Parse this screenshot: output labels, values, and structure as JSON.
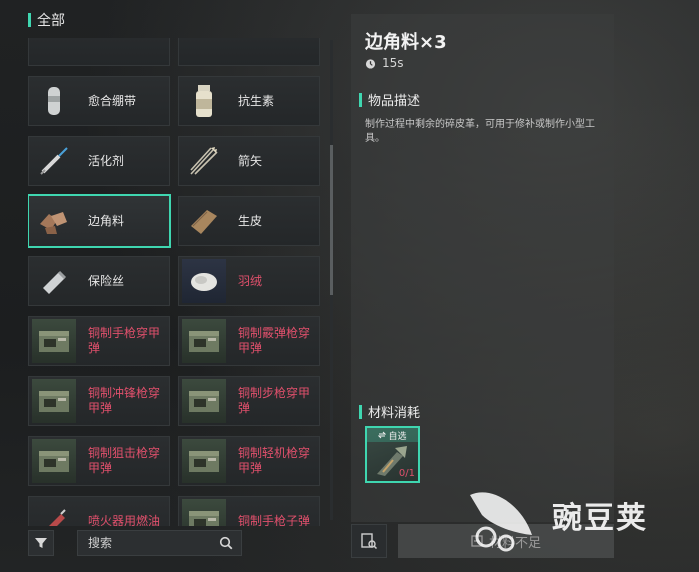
{
  "list": {
    "header": "全部",
    "items": [
      {
        "label": "",
        "icon": "partial-item-icon",
        "red": false,
        "thumb": "plain"
      },
      {
        "label": "",
        "icon": "partial-item-icon",
        "red": false,
        "thumb": "plain"
      },
      {
        "label": "愈合绷带",
        "icon": "bandage-icon",
        "red": false,
        "thumb": "plain"
      },
      {
        "label": "抗生素",
        "icon": "pill-bottle-icon",
        "red": false,
        "thumb": "plain"
      },
      {
        "label": "活化剂",
        "icon": "syringe-icon",
        "red": false,
        "thumb": "plain"
      },
      {
        "label": "箭矢",
        "icon": "arrows-icon",
        "red": false,
        "thumb": "plain"
      },
      {
        "label": "边角料",
        "icon": "leather-scraps-icon",
        "red": false,
        "thumb": "plain"
      },
      {
        "label": "生皮",
        "icon": "rawhide-icon",
        "red": false,
        "thumb": "plain"
      },
      {
        "label": "保险丝",
        "icon": "fuse-icon",
        "red": false,
        "thumb": "plain"
      },
      {
        "label": "羽绒",
        "icon": "down-feather-icon",
        "red": true,
        "thumb": "blue"
      },
      {
        "label": "铜制手枪穿甲弹",
        "icon": "ammo-box-icon",
        "red": true,
        "thumb": "green"
      },
      {
        "label": "铜制霰弹枪穿甲弹",
        "icon": "ammo-box-icon",
        "red": true,
        "thumb": "green"
      },
      {
        "label": "铜制冲锋枪穿甲弹",
        "icon": "ammo-box-icon",
        "red": true,
        "thumb": "green"
      },
      {
        "label": "铜制步枪穿甲弹",
        "icon": "ammo-box-icon",
        "red": true,
        "thumb": "green"
      },
      {
        "label": "铜制狙击枪穿甲弹",
        "icon": "ammo-box-icon",
        "red": true,
        "thumb": "green"
      },
      {
        "label": "铜制轻机枪穿甲弹",
        "icon": "ammo-box-icon",
        "red": true,
        "thumb": "green"
      },
      {
        "label": "喷火器用燃油",
        "icon": "fuel-icon",
        "red": true,
        "thumb": "plain"
      },
      {
        "label": "铜制手枪子弹",
        "icon": "ammo-box-icon",
        "red": true,
        "thumb": "green"
      }
    ],
    "selected_index": 6
  },
  "search": {
    "placeholder": "搜索"
  },
  "detail": {
    "title": "边角料×3",
    "time": "15s",
    "desc_header": "物品描述",
    "description": "制作过程中剩余的碎皮革，可用于修补或制作小型工具。",
    "materials_header": "材料消耗",
    "material_tag": "自选",
    "material_count": "0/1"
  },
  "action": {
    "craft_label": "材料不足"
  },
  "watermark": {
    "text": "豌豆荚"
  },
  "colors": {
    "accent": "#3fd6b0",
    "insufficient": "#e0506c"
  }
}
